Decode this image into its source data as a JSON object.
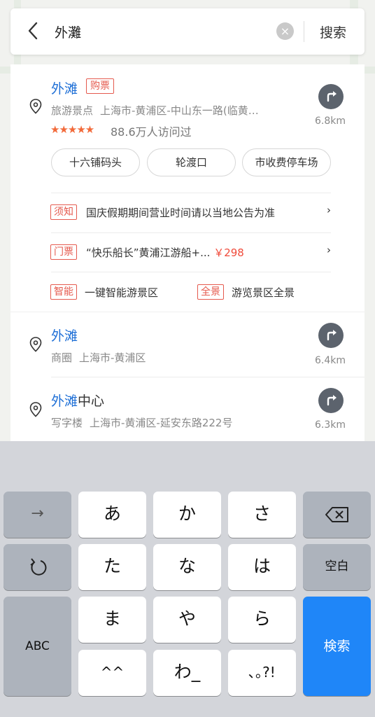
{
  "search": {
    "query": "外灘",
    "clear_glyph": "×",
    "button_label": "搜索"
  },
  "results": [
    {
      "title": "外滩",
      "badge": "购票",
      "category": "旅游景点",
      "address": "上海市-黄浦区-中山东一路(临黄…",
      "rating_stars": "★★★★★",
      "rating": 4.5,
      "visitors": "88.6万人访问过",
      "distance": "6.8km",
      "chips": [
        "十六铺码头",
        "轮渡口",
        "市收费停车场"
      ],
      "notices": [
        {
          "tag": "须知",
          "text": "国庆假期期间营业时间请以当地公告为准",
          "chevron": "›"
        },
        {
          "tag": "门票",
          "text": "“快乐船长”黄浦江游船+...",
          "price": "￥298",
          "chevron": "›"
        }
      ],
      "features": [
        {
          "tag": "智能",
          "text": "一键智能游景区"
        },
        {
          "tag": "全景",
          "text": "游览景区全景"
        }
      ]
    },
    {
      "title": "外滩",
      "category": "商圈",
      "address": "上海市-黄浦区",
      "distance": "6.4km"
    },
    {
      "title_highlight": "外滩",
      "title_rest": "中心",
      "category": "写字楼",
      "address": "上海市-黄浦区-延安东路222号",
      "distance": "6.3km"
    }
  ],
  "keyboard": {
    "rows": [
      [
        "→",
        "あ",
        "か",
        "さ",
        "⌫"
      ],
      [
        "↺",
        "た",
        "な",
        "は",
        "空白"
      ],
      [
        "ABC",
        "ま",
        "や",
        "ら",
        "検索"
      ],
      [
        "^^",
        "わ_",
        "､｡?!"
      ]
    ]
  },
  "colors": {
    "accent_blue": "#1e6fd6",
    "tag_red": "#e55a4e",
    "price_red": "#f04a3a",
    "star_orange": "#f26a3a",
    "key_blue": "#1f86f8"
  }
}
